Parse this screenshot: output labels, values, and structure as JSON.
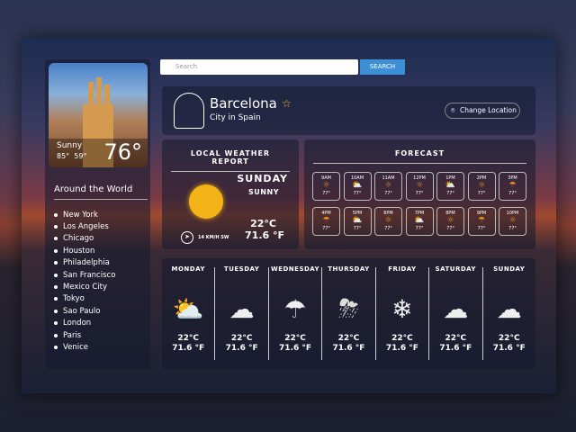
{
  "current": {
    "condition": "Sunny",
    "high": "85°",
    "low": "59°",
    "temp": "76°"
  },
  "sidebar": {
    "title": "Around the World",
    "cities": [
      "New York",
      "Los Angeles",
      "Chicago",
      "Houston",
      "Philadelphia",
      "San Francisco",
      "Mexico City",
      "Tokyo",
      "Sao Paulo",
      "London",
      "Paris",
      "Venice"
    ]
  },
  "search": {
    "placeholder": "Search",
    "button": "SEARCH"
  },
  "location": {
    "city": "Barcelona",
    "subtitle": "City in Spain",
    "change_label": "Change Location",
    "favorite_icon": "star-icon"
  },
  "local_report": {
    "title": "LOCAL WEATHER REPORT",
    "day": "SUNDAY",
    "condition": "SUNNY",
    "celsius": "22°C",
    "fahrenheit": "71.6 °F",
    "wind": "14 KM/H SW"
  },
  "forecast": {
    "title": "FORECAST",
    "hours": [
      {
        "time": "9AM",
        "icon": "sun",
        "temp": "77°"
      },
      {
        "time": "10AM",
        "icon": "partly-cloudy",
        "temp": "77°"
      },
      {
        "time": "11AM",
        "icon": "sun",
        "temp": "77°"
      },
      {
        "time": "12PM",
        "icon": "sun",
        "temp": "77°"
      },
      {
        "time": "1PM",
        "icon": "partly-cloudy",
        "temp": "77°"
      },
      {
        "time": "2PM",
        "icon": "sun",
        "temp": "77°"
      },
      {
        "time": "3PM",
        "icon": "rain",
        "temp": "77°"
      },
      {
        "time": "4PM",
        "icon": "rain",
        "temp": "77°"
      },
      {
        "time": "5PM",
        "icon": "partly-cloudy",
        "temp": "77°"
      },
      {
        "time": "6PM",
        "icon": "sun",
        "temp": "77°"
      },
      {
        "time": "7PM",
        "icon": "partly-cloudy",
        "temp": "77°"
      },
      {
        "time": "8PM",
        "icon": "sun",
        "temp": "77°"
      },
      {
        "time": "9PM",
        "icon": "rain",
        "temp": "77°"
      },
      {
        "time": "10PM",
        "icon": "sun",
        "temp": "77°"
      }
    ]
  },
  "week": [
    {
      "day": "MONDAY",
      "icon": "partly-cloudy",
      "c": "22°C",
      "f": "71.6 °F"
    },
    {
      "day": "TUESDAY",
      "icon": "cloudy",
      "c": "22°C",
      "f": "71.6 °F"
    },
    {
      "day": "WEDNESDAY",
      "icon": "rain",
      "c": "22°C",
      "f": "71.6 °F"
    },
    {
      "day": "THURSDAY",
      "icon": "thunderstorm",
      "c": "22°C",
      "f": "71.6 °F"
    },
    {
      "day": "FRIDAY",
      "icon": "snow",
      "c": "22°C",
      "f": "71.6 °F"
    },
    {
      "day": "SATURDAY",
      "icon": "cloudy",
      "c": "22°C",
      "f": "71.6 °F"
    },
    {
      "day": "SUNDAY",
      "icon": "cloudy",
      "c": "22°C",
      "f": "71.6 °F"
    }
  ],
  "colors": {
    "accent": "#3d8fd6",
    "sun": "#f3b316",
    "icon_orange": "#f09020"
  }
}
